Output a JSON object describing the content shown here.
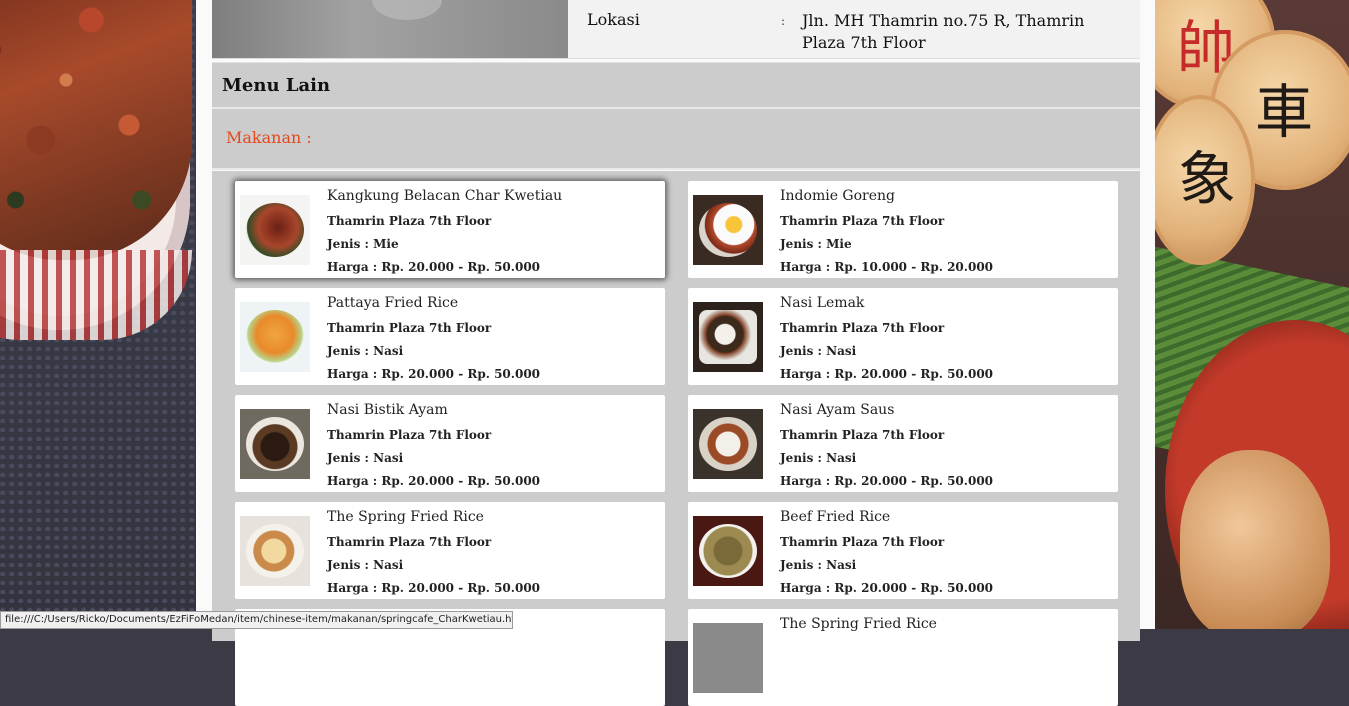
{
  "location": {
    "label": "Lokasi",
    "colon": ":",
    "value": "Jln. MH Thamrin no.75 R, Thamrin Plaza 7th Floor"
  },
  "section_title": "Menu Lain",
  "category_label": "Makanan :",
  "menu_items": [
    {
      "name": "Kangkung Belacan Char Kwetiau",
      "place": "Thamrin Plaza 7th Floor",
      "type": "Jenis : Mie",
      "price": "Harga : Rp. 20.000 - Rp. 50.000",
      "image": "kwetiau-photo"
    },
    {
      "name": "Indomie Goreng",
      "place": "Thamrin Plaza 7th Floor",
      "type": "Jenis : Mie",
      "price": "Harga : Rp. 10.000 - Rp. 20.000",
      "image": "indomie-photo"
    },
    {
      "name": "Pattaya Fried Rice",
      "place": "Thamrin Plaza 7th Floor",
      "type": "Jenis : Nasi",
      "price": "Harga : Rp. 20.000 - Rp. 50.000",
      "image": "pattaya-photo"
    },
    {
      "name": "Nasi Lemak",
      "place": "Thamrin Plaza 7th Floor",
      "type": "Jenis : Nasi",
      "price": "Harga : Rp. 20.000 - Rp. 50.000",
      "image": "nasi-lemak-photo"
    },
    {
      "name": "Nasi Bistik Ayam",
      "place": "Thamrin Plaza 7th Floor",
      "type": "Jenis : Nasi",
      "price": "Harga : Rp. 20.000 - Rp. 50.000",
      "image": "bistik-photo"
    },
    {
      "name": "Nasi Ayam Saus",
      "place": "Thamrin Plaza 7th Floor",
      "type": "Jenis : Nasi",
      "price": "Harga : Rp. 20.000 - Rp. 50.000",
      "image": "ayam-saus-photo"
    },
    {
      "name": "The Spring Fried Rice",
      "place": "Thamrin Plaza 7th Floor",
      "type": "Jenis : Nasi",
      "price": "Harga : Rp. 20.000 - Rp. 50.000",
      "image": "spring-rice-photo"
    },
    {
      "name": "Beef Fried Rice",
      "place": "Thamrin Plaza 7th Floor",
      "type": "Jenis : Nasi",
      "price": "Harga : Rp. 20.000 - Rp. 50.000",
      "image": "beef-rice-photo"
    },
    {
      "name": "",
      "place": "",
      "type": "",
      "price": "",
      "image": ""
    },
    {
      "name": "The Spring Fried Rice",
      "place": "",
      "type": "",
      "price": "",
      "image": "spring-rice-photo"
    }
  ],
  "status_bar": {
    "url": "file:///C:/Users/Ricko/Documents/EzFiFoMedan/item/chinese-item/makanan/springcafe_CharKwetiau.html"
  },
  "colors": {
    "accent": "#e4491c",
    "section_bg": "#cccccc",
    "card_bg": "#ffffff"
  }
}
